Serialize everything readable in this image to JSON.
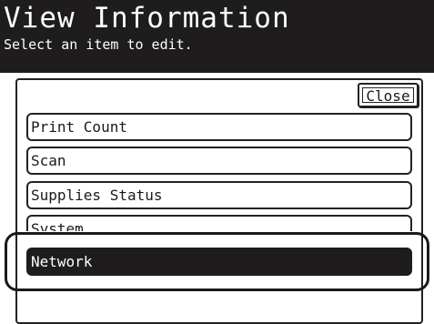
{
  "header": {
    "title": "View Information",
    "subtitle": "Select an item to edit."
  },
  "close_button": {
    "label": "Close"
  },
  "menu": {
    "items": [
      {
        "label": "Print Count",
        "selected": false
      },
      {
        "label": "Scan",
        "selected": false
      },
      {
        "label": "Supplies Status",
        "selected": false
      },
      {
        "label": "System",
        "selected": false
      },
      {
        "label": "Network",
        "selected": true
      }
    ]
  },
  "colors": {
    "header_bg": "#1e1c1c",
    "selected_bg": "#1e1c1c",
    "text": "#1a1a1a"
  }
}
